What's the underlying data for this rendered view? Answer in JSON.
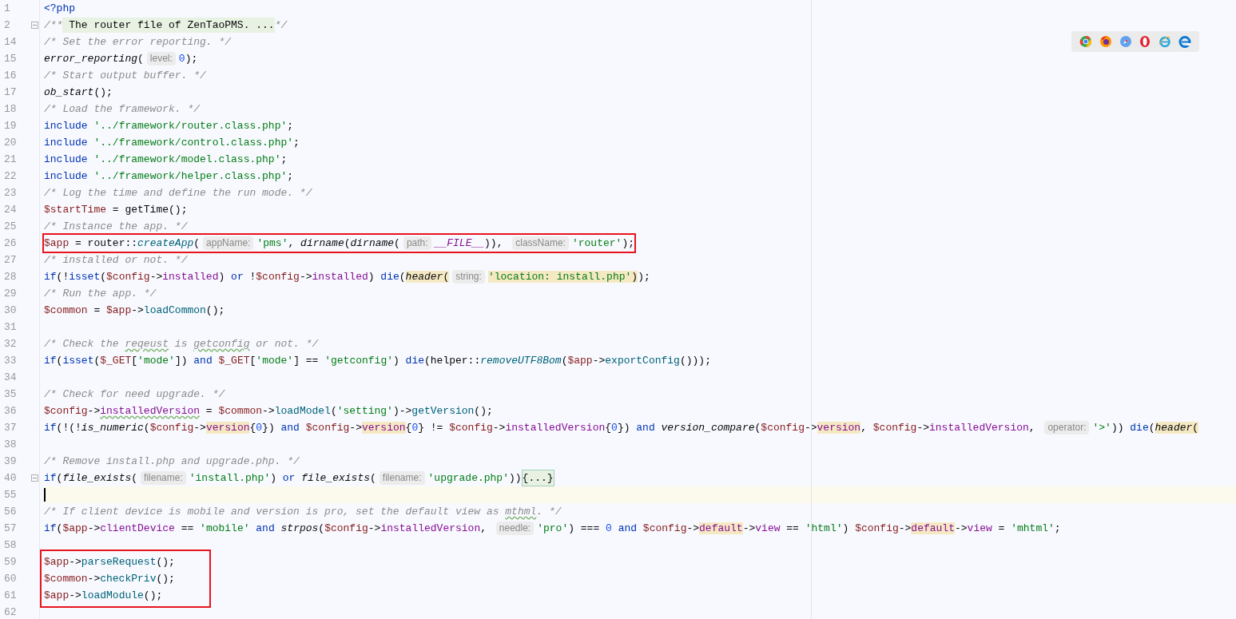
{
  "editor": {
    "lines": [
      {
        "number": "1",
        "tokens": [
          {
            "text": "<?php",
            "kind": "kw"
          }
        ]
      },
      {
        "number": "2",
        "foldable": true,
        "tokens": [
          {
            "text": "/**",
            "kind": "cmt"
          },
          {
            "text": " The router file of ZenTaoPMS. ...",
            "kind": "fold_text"
          },
          {
            "text": "*/",
            "kind": "cmt"
          }
        ]
      },
      {
        "number": "14",
        "tokens": [
          {
            "text": "/* Set the error reporting. */",
            "kind": "cmt"
          }
        ]
      },
      {
        "number": "15",
        "tokens": [
          {
            "text": "error_reporting",
            "kind": "fn"
          },
          {
            "text": "(",
            "kind": "plain"
          },
          {
            "text": "level:",
            "kind": "hint"
          },
          {
            "text": "0",
            "kind": "num"
          },
          {
            "text": ");",
            "kind": "plain"
          }
        ]
      },
      {
        "number": "16",
        "tokens": [
          {
            "text": "/* Start output buffer. */",
            "kind": "cmt"
          }
        ]
      },
      {
        "number": "17",
        "tokens": [
          {
            "text": "ob_start",
            "kind": "fn"
          },
          {
            "text": "();",
            "kind": "plain"
          }
        ]
      },
      {
        "number": "18",
        "tokens": [
          {
            "text": "/* Load the framework. */",
            "kind": "cmt"
          }
        ]
      },
      {
        "number": "19",
        "tokens": [
          {
            "text": "include ",
            "kind": "kw"
          },
          {
            "text": "'../framework/router.class.php'",
            "kind": "str"
          },
          {
            "text": ";",
            "kind": "plain"
          }
        ]
      },
      {
        "number": "20",
        "tokens": [
          {
            "text": "include ",
            "kind": "kw"
          },
          {
            "text": "'../framework/control.class.php'",
            "kind": "str"
          },
          {
            "text": ";",
            "kind": "plain"
          }
        ]
      },
      {
        "number": "21",
        "tokens": [
          {
            "text": "include ",
            "kind": "kw"
          },
          {
            "text": "'../framework/model.class.php'",
            "kind": "str"
          },
          {
            "text": ";",
            "kind": "plain"
          }
        ]
      },
      {
        "number": "22",
        "tokens": [
          {
            "text": "include ",
            "kind": "kw"
          },
          {
            "text": "'../framework/helper.class.php'",
            "kind": "str"
          },
          {
            "text": ";",
            "kind": "plain"
          }
        ]
      },
      {
        "number": "23",
        "tokens": [
          {
            "text": "/* Log the time and define the run mode. */",
            "kind": "cmt"
          }
        ]
      },
      {
        "number": "24",
        "tokens": [
          {
            "text": "$startTime",
            "kind": "var"
          },
          {
            "text": " = getTime();",
            "kind": "plain"
          }
        ]
      },
      {
        "number": "25",
        "tokens": [
          {
            "text": "/* Instance the app. */",
            "kind": "cmt"
          }
        ]
      },
      {
        "number": "26",
        "framed": true,
        "tokens": [
          {
            "text": "$app",
            "kind": "var"
          },
          {
            "text": " = router::",
            "kind": "plain"
          },
          {
            "text": "createApp",
            "kind": "sfn"
          },
          {
            "text": "(",
            "kind": "plain"
          },
          {
            "text": "appName:",
            "kind": "hint"
          },
          {
            "text": "'pms'",
            "kind": "str"
          },
          {
            "text": ", ",
            "kind": "plain"
          },
          {
            "text": "dirname",
            "kind": "fn"
          },
          {
            "text": "(",
            "kind": "plain"
          },
          {
            "text": "dirname",
            "kind": "fn"
          },
          {
            "text": "(",
            "kind": "plain"
          },
          {
            "text": "path:",
            "kind": "hint"
          },
          {
            "text": "__FILE__",
            "kind": "const"
          },
          {
            "text": ")), ",
            "kind": "plain"
          },
          {
            "text": "className:",
            "kind": "hint"
          },
          {
            "text": "'router'",
            "kind": "str"
          },
          {
            "text": ");",
            "kind": "plain"
          }
        ]
      },
      {
        "number": "27",
        "tokens": [
          {
            "text": "/* installed or not. */",
            "kind": "cmt"
          }
        ]
      },
      {
        "number": "28",
        "tokens": [
          {
            "text": "if",
            "kind": "kw"
          },
          {
            "text": "(!",
            "kind": "plain"
          },
          {
            "text": "isset",
            "kind": "kw"
          },
          {
            "text": "(",
            "kind": "plain"
          },
          {
            "text": "$config",
            "kind": "var"
          },
          {
            "text": "->",
            "kind": "plain"
          },
          {
            "text": "installed",
            "kind": "prop"
          },
          {
            "text": ") ",
            "kind": "plain"
          },
          {
            "text": "or",
            "kind": "kw"
          },
          {
            "text": " !",
            "kind": "plain"
          },
          {
            "text": "$config",
            "kind": "var"
          },
          {
            "text": "->",
            "kind": "plain"
          },
          {
            "text": "installed",
            "kind": "prop"
          },
          {
            "text": ") ",
            "kind": "plain"
          },
          {
            "text": "die",
            "kind": "kw"
          },
          {
            "text": "(",
            "kind": "plain"
          },
          {
            "text": "header",
            "kind": "fn",
            "match": true
          },
          {
            "text": "(",
            "kind": "plain",
            "match": true
          },
          {
            "text": "string:",
            "kind": "hint"
          },
          {
            "text": "'location: install.php'",
            "kind": "str",
            "match": true
          },
          {
            "text": ")",
            "kind": "plain",
            "match": true
          },
          {
            "text": ");",
            "kind": "plain"
          }
        ]
      },
      {
        "number": "29",
        "tokens": [
          {
            "text": "/* Run the app. */",
            "kind": "cmt"
          }
        ]
      },
      {
        "number": "30",
        "tokens": [
          {
            "text": "$common",
            "kind": "var"
          },
          {
            "text": " = ",
            "kind": "plain"
          },
          {
            "text": "$app",
            "kind": "var"
          },
          {
            "text": "->",
            "kind": "plain"
          },
          {
            "text": "loadCommon",
            "kind": "method"
          },
          {
            "text": "();",
            "kind": "plain"
          }
        ]
      },
      {
        "number": "31"
      },
      {
        "number": "32",
        "tokens": [
          {
            "text": "/* Check the ",
            "kind": "cmt"
          },
          {
            "text": "reqeust",
            "kind": "cmt",
            "typo": true
          },
          {
            "text": " is ",
            "kind": "cmt"
          },
          {
            "text": "getconfig",
            "kind": "cmt",
            "typo": true
          },
          {
            "text": " or not. */",
            "kind": "cmt"
          }
        ]
      },
      {
        "number": "33",
        "tokens": [
          {
            "text": "if",
            "kind": "kw"
          },
          {
            "text": "(",
            "kind": "plain"
          },
          {
            "text": "isset",
            "kind": "kw"
          },
          {
            "text": "(",
            "kind": "plain"
          },
          {
            "text": "$_GET",
            "kind": "var"
          },
          {
            "text": "[",
            "kind": "plain"
          },
          {
            "text": "'mode'",
            "kind": "str"
          },
          {
            "text": "]) ",
            "kind": "plain"
          },
          {
            "text": "and ",
            "kind": "kw"
          },
          {
            "text": "$_GET",
            "kind": "var"
          },
          {
            "text": "[",
            "kind": "plain"
          },
          {
            "text": "'mode'",
            "kind": "str"
          },
          {
            "text": "] == ",
            "kind": "plain"
          },
          {
            "text": "'getconfig'",
            "kind": "str"
          },
          {
            "text": ") ",
            "kind": "plain"
          },
          {
            "text": "die",
            "kind": "kw"
          },
          {
            "text": "(helper::",
            "kind": "plain"
          },
          {
            "text": "removeUTF8Bom",
            "kind": "sfn"
          },
          {
            "text": "(",
            "kind": "plain"
          },
          {
            "text": "$app",
            "kind": "var"
          },
          {
            "text": "->",
            "kind": "plain"
          },
          {
            "text": "exportConfig",
            "kind": "method"
          },
          {
            "text": "()));",
            "kind": "plain"
          }
        ]
      },
      {
        "number": "34"
      },
      {
        "number": "35",
        "tokens": [
          {
            "text": "/* Check for need upgrade. */",
            "kind": "cmt"
          }
        ]
      },
      {
        "number": "36",
        "tokens": [
          {
            "text": "$config",
            "kind": "var"
          },
          {
            "text": "->",
            "kind": "plain"
          },
          {
            "text": "installedVersion",
            "kind": "prop",
            "typo": true
          },
          {
            "text": " = ",
            "kind": "plain"
          },
          {
            "text": "$common",
            "kind": "var"
          },
          {
            "text": "->",
            "kind": "plain"
          },
          {
            "text": "loadModel",
            "kind": "method"
          },
          {
            "text": "(",
            "kind": "plain"
          },
          {
            "text": "'setting'",
            "kind": "str"
          },
          {
            "text": ")->",
            "kind": "plain"
          },
          {
            "text": "getVersion",
            "kind": "method"
          },
          {
            "text": "();",
            "kind": "plain"
          }
        ]
      },
      {
        "number": "37",
        "tokens": [
          {
            "text": "if",
            "kind": "kw"
          },
          {
            "text": "(!(!",
            "kind": "plain"
          },
          {
            "text": "is_numeric",
            "kind": "fn"
          },
          {
            "text": "(",
            "kind": "plain"
          },
          {
            "text": "$config",
            "kind": "var"
          },
          {
            "text": "->",
            "kind": "plain"
          },
          {
            "text": "version",
            "kind": "prop",
            "match": true
          },
          {
            "text": "{",
            "kind": "plain"
          },
          {
            "text": "0",
            "kind": "num"
          },
          {
            "text": "}) ",
            "kind": "plain"
          },
          {
            "text": "and ",
            "kind": "kw"
          },
          {
            "text": "$config",
            "kind": "var"
          },
          {
            "text": "->",
            "kind": "plain"
          },
          {
            "text": "version",
            "kind": "prop",
            "match": true
          },
          {
            "text": "{",
            "kind": "plain"
          },
          {
            "text": "0",
            "kind": "num"
          },
          {
            "text": "} != ",
            "kind": "plain"
          },
          {
            "text": "$config",
            "kind": "var"
          },
          {
            "text": "->",
            "kind": "plain"
          },
          {
            "text": "installedVersion",
            "kind": "prop"
          },
          {
            "text": "{",
            "kind": "plain"
          },
          {
            "text": "0",
            "kind": "num"
          },
          {
            "text": "}) ",
            "kind": "plain"
          },
          {
            "text": "and ",
            "kind": "kw"
          },
          {
            "text": "version_compare",
            "kind": "fn"
          },
          {
            "text": "(",
            "kind": "plain"
          },
          {
            "text": "$config",
            "kind": "var"
          },
          {
            "text": "->",
            "kind": "plain"
          },
          {
            "text": "version",
            "kind": "prop",
            "match": true
          },
          {
            "text": ", ",
            "kind": "plain"
          },
          {
            "text": "$config",
            "kind": "var"
          },
          {
            "text": "->",
            "kind": "plain"
          },
          {
            "text": "installedVersion",
            "kind": "prop"
          },
          {
            "text": ", ",
            "kind": "plain"
          },
          {
            "text": "operator:",
            "kind": "hint"
          },
          {
            "text": "'>'",
            "kind": "str"
          },
          {
            "text": ")) ",
            "kind": "plain"
          },
          {
            "text": "die",
            "kind": "kw"
          },
          {
            "text": "(",
            "kind": "plain"
          },
          {
            "text": "header",
            "kind": "fn",
            "match": true
          },
          {
            "text": "(",
            "kind": "plain",
            "match": true
          }
        ]
      },
      {
        "number": "38"
      },
      {
        "number": "39",
        "tokens": [
          {
            "text": "/* Remove install.php and upgrade.php. */",
            "kind": "cmt"
          }
        ]
      },
      {
        "number": "40",
        "foldable": true,
        "tokens": [
          {
            "text": "if",
            "kind": "kw"
          },
          {
            "text": "(",
            "kind": "plain"
          },
          {
            "text": "file_exists",
            "kind": "fn"
          },
          {
            "text": "(",
            "kind": "plain"
          },
          {
            "text": "filename:",
            "kind": "hint"
          },
          {
            "text": "'install.php'",
            "kind": "str"
          },
          {
            "text": ") ",
            "kind": "plain"
          },
          {
            "text": "or ",
            "kind": "kw"
          },
          {
            "text": "file_exists",
            "kind": "fn"
          },
          {
            "text": "(",
            "kind": "plain"
          },
          {
            "text": "filename:",
            "kind": "hint"
          },
          {
            "text": "'upgrade.php'",
            "kind": "str"
          },
          {
            "text": "))",
            "kind": "plain"
          },
          {
            "text": "{...}",
            "kind": "fold_block"
          }
        ]
      },
      {
        "number": "55",
        "current": true
      },
      {
        "number": "56",
        "tokens": [
          {
            "text": "/* If client device is mobile and version is pro, set the default view as ",
            "kind": "cmt"
          },
          {
            "text": "mthml",
            "kind": "cmt",
            "typo": true
          },
          {
            "text": ". */",
            "kind": "cmt"
          }
        ]
      },
      {
        "number": "57",
        "tokens": [
          {
            "text": "if",
            "kind": "kw"
          },
          {
            "text": "(",
            "kind": "plain"
          },
          {
            "text": "$app",
            "kind": "var"
          },
          {
            "text": "->",
            "kind": "plain"
          },
          {
            "text": "clientDevice",
            "kind": "prop"
          },
          {
            "text": " == ",
            "kind": "plain"
          },
          {
            "text": "'mobile' ",
            "kind": "str"
          },
          {
            "text": "and ",
            "kind": "kw"
          },
          {
            "text": "strpos",
            "kind": "fn"
          },
          {
            "text": "(",
            "kind": "plain"
          },
          {
            "text": "$config",
            "kind": "var"
          },
          {
            "text": "->",
            "kind": "plain"
          },
          {
            "text": "installedVersion",
            "kind": "prop"
          },
          {
            "text": ", ",
            "kind": "plain"
          },
          {
            "text": "needle:",
            "kind": "hint"
          },
          {
            "text": "'pro'",
            "kind": "str"
          },
          {
            "text": ") === ",
            "kind": "plain"
          },
          {
            "text": "0 ",
            "kind": "num"
          },
          {
            "text": "and ",
            "kind": "kw"
          },
          {
            "text": "$config",
            "kind": "var"
          },
          {
            "text": "->",
            "kind": "plain"
          },
          {
            "text": "default",
            "kind": "prop",
            "match": true
          },
          {
            "text": "->",
            "kind": "plain"
          },
          {
            "text": "view",
            "kind": "prop"
          },
          {
            "text": " == ",
            "kind": "plain"
          },
          {
            "text": "'html'",
            "kind": "str"
          },
          {
            "text": ") ",
            "kind": "plain"
          },
          {
            "text": "$config",
            "kind": "var"
          },
          {
            "text": "->",
            "kind": "plain"
          },
          {
            "text": "default",
            "kind": "prop",
            "match": true
          },
          {
            "text": "->",
            "kind": "plain"
          },
          {
            "text": "view",
            "kind": "prop"
          },
          {
            "text": " = ",
            "kind": "plain"
          },
          {
            "text": "'mhtml'",
            "kind": "str"
          },
          {
            "text": ";",
            "kind": "plain"
          }
        ]
      },
      {
        "number": "58"
      },
      {
        "number": "59",
        "framed": true,
        "tokens": [
          {
            "text": "$app",
            "kind": "var"
          },
          {
            "text": "->",
            "kind": "plain"
          },
          {
            "text": "parseRequest",
            "kind": "method"
          },
          {
            "text": "();",
            "kind": "plain"
          }
        ]
      },
      {
        "number": "60",
        "framed": true,
        "tokens": [
          {
            "text": "$common",
            "kind": "var"
          },
          {
            "text": "->",
            "kind": "plain"
          },
          {
            "text": "checkPriv",
            "kind": "method"
          },
          {
            "text": "();",
            "kind": "plain"
          }
        ]
      },
      {
        "number": "61",
        "framed": true,
        "tokens": [
          {
            "text": "$app",
            "kind": "var"
          },
          {
            "text": "->",
            "kind": "plain"
          },
          {
            "text": "loadModule",
            "kind": "method"
          },
          {
            "text": "();",
            "kind": "plain"
          }
        ]
      },
      {
        "number": "62"
      }
    ]
  }
}
